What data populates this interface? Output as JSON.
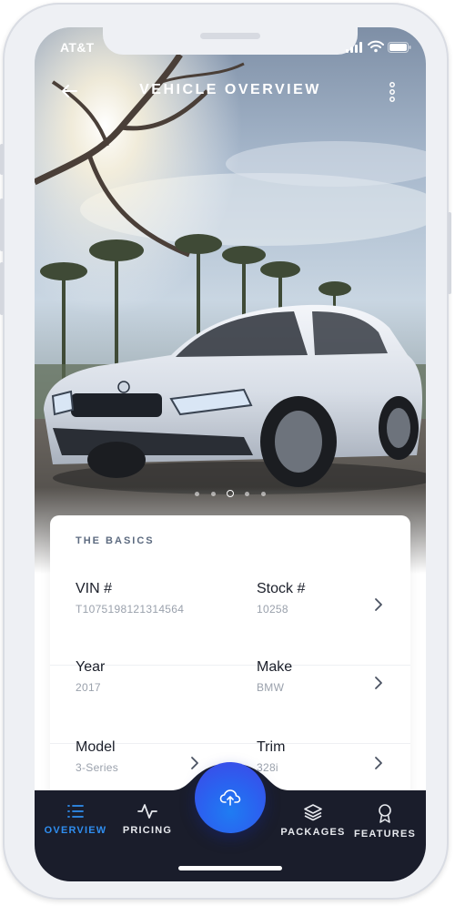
{
  "status_bar": {
    "carrier": "AT&T"
  },
  "nav": {
    "title": "VEHICLE OVERVIEW",
    "back_icon": "arrow-left-icon",
    "more_icon": "more-vertical-icon"
  },
  "gallery": {
    "page_count": 5,
    "active_index": 2
  },
  "basics": {
    "title": "THE BASICS",
    "rows": [
      {
        "left": {
          "label": "VIN #",
          "value": "T1075198121314564"
        },
        "right": {
          "label": "Stock #",
          "value": "10258"
        }
      },
      {
        "left": {
          "label": "Year",
          "value": "2017"
        },
        "right": {
          "label": "Make",
          "value": "BMW"
        }
      },
      {
        "left": {
          "label": "Model",
          "value": "3-Series"
        },
        "right": {
          "label": "Trim",
          "value": "328i"
        }
      }
    ]
  },
  "tabbar": {
    "tabs": [
      {
        "label": "OVERVIEW",
        "icon": "list-icon",
        "active": true
      },
      {
        "label": "PRICING",
        "icon": "activity-icon",
        "active": false
      },
      {
        "label": "PACKAGES",
        "icon": "layers-icon",
        "active": false
      },
      {
        "label": "FEATURES",
        "icon": "award-icon",
        "active": false
      }
    ],
    "center_action_icon": "cloud-upload-icon"
  },
  "colors": {
    "accent": "#2f8ef0",
    "tabbar_bg": "#1a1d2b",
    "fab_start": "#1f7cf2",
    "fab_end": "#3f46e6"
  }
}
